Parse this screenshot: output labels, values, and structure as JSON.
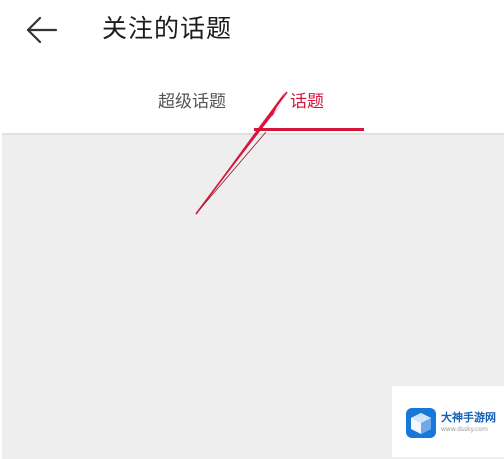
{
  "header": {
    "back_icon": "arrow-left-icon",
    "title": "关注的话题"
  },
  "tabs": [
    {
      "label": "超级话题",
      "active": false
    },
    {
      "label": "话题",
      "active": true
    }
  ],
  "colors": {
    "accent": "#d6153b",
    "content_bg": "#eeeeee",
    "title_text": "#1c1c1c",
    "inactive_tab": "#555555"
  },
  "watermark": {
    "name": "大神手游网",
    "url": "www.dssky.com"
  }
}
